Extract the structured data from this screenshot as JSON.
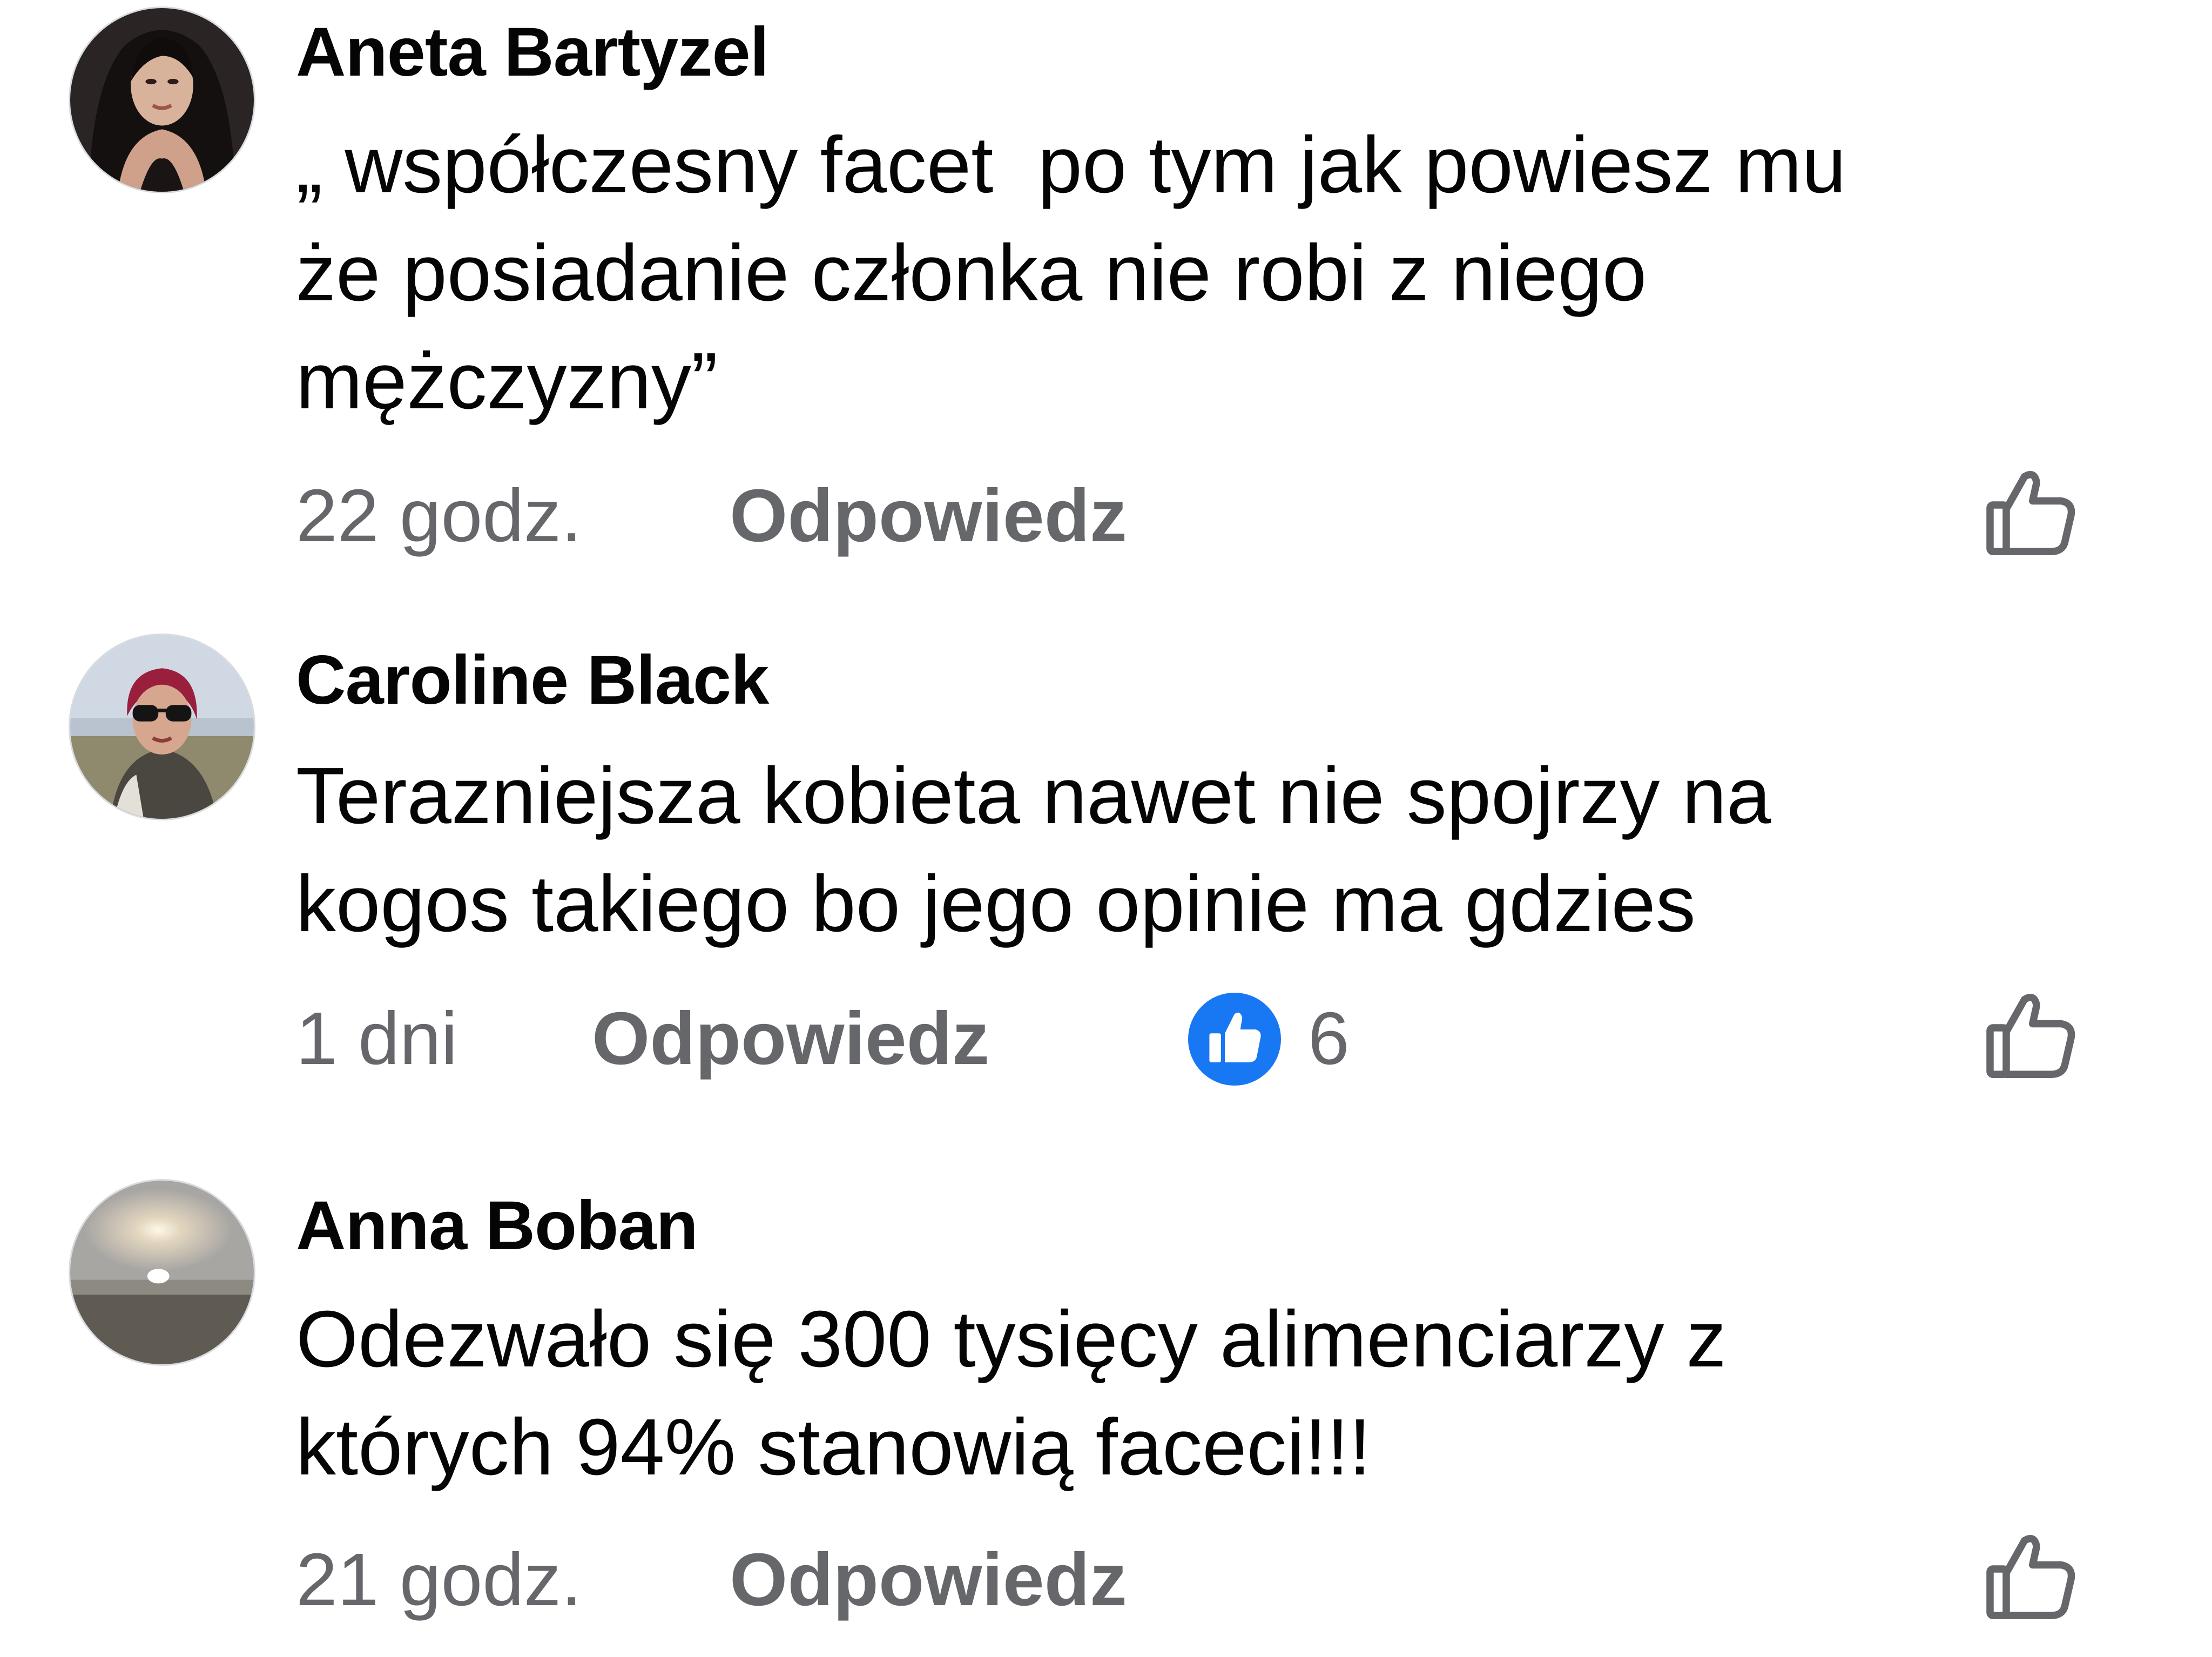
{
  "comments": [
    {
      "author": "Aneta Bartyzel",
      "text": "„ współczesny facet  po tym jak powiesz mu\nże posiadanie członka nie robi z niego\nmężczyzny”",
      "time": "22 godz.",
      "reply_label": "Odpowiedz",
      "avatar_icon": "avatar-photo"
    },
    {
      "author": "Caroline Black",
      "text": "Terazniejsza kobieta nawet nie spojrzy na\nkogos takiego bo jego opinie ma gdzies",
      "time": "1 dni",
      "reply_label": "Odpowiedz",
      "reactions": {
        "icon": "like-reaction-icon",
        "count": "6"
      },
      "avatar_icon": "avatar-photo"
    },
    {
      "author": "Anna Boban",
      "text": "Odezwało się 300 tysięcy alimenciarzy z\nktórych 94% stanowią faceci!!!",
      "time": "21 godz.",
      "reply_label": "Odpowiedz",
      "avatar_icon": "avatar-photo"
    }
  ],
  "like_icon": "thumbs-up-outline-icon",
  "colors": {
    "text": "#050505",
    "secondary": "#65676b",
    "reaction_blue": "#1877f2",
    "background": "#ffffff"
  }
}
